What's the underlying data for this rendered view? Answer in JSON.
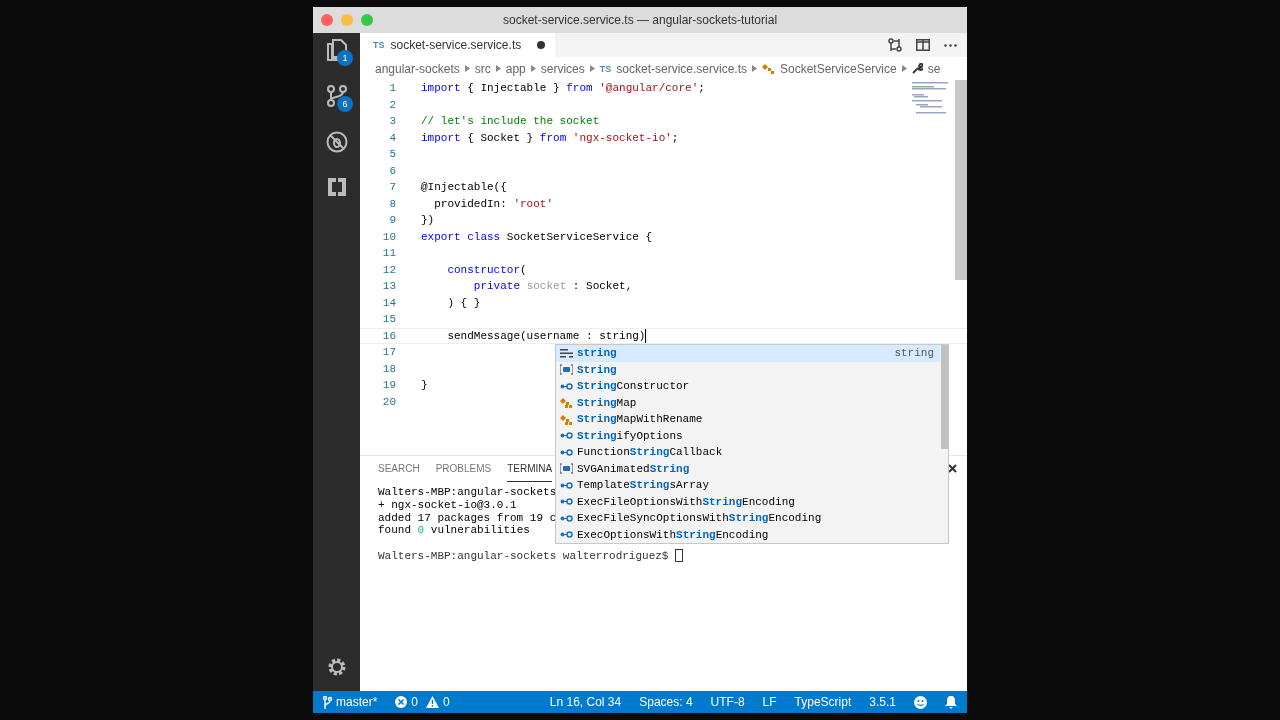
{
  "window": {
    "title": "socket-service.service.ts — angular-sockets-tutorial"
  },
  "activity_bar": {
    "items": [
      {
        "kind": "files",
        "badge": "1"
      },
      {
        "kind": "source-control",
        "badge": "6"
      },
      {
        "kind": "debug"
      },
      {
        "kind": "extensions"
      }
    ]
  },
  "tab": {
    "icon_text": "TS",
    "label": "socket-service.service.ts",
    "dirty": true
  },
  "breadcrumbs": [
    {
      "kind": "folder",
      "label": "angular-sockets"
    },
    {
      "kind": "folder",
      "label": "src"
    },
    {
      "kind": "folder",
      "label": "app"
    },
    {
      "kind": "folder",
      "label": "services"
    },
    {
      "kind": "file",
      "icon_text": "TS",
      "label": "socket-service.service.ts"
    },
    {
      "kind": "class",
      "label": "SocketServiceService"
    },
    {
      "kind": "property",
      "label": "se"
    }
  ],
  "code_lines": [
    {
      "number": "1",
      "current": false,
      "tokens": [
        {
          "text": "import",
          "kind": "kw"
        },
        {
          "text": " { Injectable } ",
          "kind": "plain"
        },
        {
          "text": "from",
          "kind": "kw"
        },
        {
          "text": " '@angular/core'",
          "kind": "str"
        },
        {
          "text": ";",
          "kind": "plain"
        }
      ]
    },
    {
      "number": "2",
      "current": false
    },
    {
      "number": "3",
      "current": false,
      "tokens": [
        {
          "text": "// let's include the socket",
          "kind": "com"
        }
      ]
    },
    {
      "number": "4",
      "current": false,
      "tokens": [
        {
          "text": "import",
          "kind": "kw"
        },
        {
          "text": " { Socket } ",
          "kind": "plain"
        },
        {
          "text": "from",
          "kind": "kw"
        },
        {
          "text": " 'ngx-socket-io'",
          "kind": "str"
        },
        {
          "text": ";",
          "kind": "plain"
        }
      ]
    },
    {
      "number": "5",
      "current": false
    },
    {
      "number": "6",
      "current": false
    },
    {
      "number": "7",
      "current": false,
      "tokens": [
        {
          "text": "@Injectable({",
          "kind": "plain"
        }
      ]
    },
    {
      "number": "8",
      "current": false,
      "tokens": [
        {
          "text": "  providedIn: ",
          "kind": "plain"
        },
        {
          "text": "'root'",
          "kind": "str"
        }
      ]
    },
    {
      "number": "9",
      "current": false,
      "tokens": [
        {
          "text": "})",
          "kind": "plain"
        }
      ]
    },
    {
      "number": "10",
      "current": false,
      "tokens": [
        {
          "text": "export class",
          "kind": "kw"
        },
        {
          "text": " SocketServiceService {",
          "kind": "plain"
        }
      ]
    },
    {
      "number": "11",
      "current": false
    },
    {
      "number": "12",
      "current": false,
      "tokens": [
        {
          "text": "    constructor",
          "kind": "kw"
        },
        {
          "text": "(",
          "kind": "plain"
        }
      ]
    },
    {
      "number": "13",
      "current": false,
      "tokens": [
        {
          "text": "        private",
          "kind": "kw"
        },
        {
          "text": " socket",
          "kind": "dim"
        },
        {
          "text": " : Socket,",
          "kind": "plain"
        }
      ]
    },
    {
      "number": "14",
      "current": false,
      "tokens": [
        {
          "text": "    ) { }",
          "kind": "plain"
        }
      ]
    },
    {
      "number": "15",
      "current": false
    },
    {
      "number": "16",
      "current": true,
      "tokens": [
        {
          "text": "    sendMessage(username : string)",
          "kind": "plain"
        }
      ]
    },
    {
      "number": "17",
      "current": false
    },
    {
      "number": "18",
      "current": false
    },
    {
      "number": "19",
      "current": false,
      "tokens": [
        {
          "text": "}",
          "kind": "plain"
        }
      ]
    },
    {
      "number": "20",
      "current": false
    }
  ],
  "suggestions": [
    {
      "kind": "keyword",
      "selected": true,
      "parts": [
        {
          "text": "string",
          "match": true
        }
      ],
      "detail": "string"
    },
    {
      "kind": "variable",
      "selected": false,
      "parts": [
        {
          "text": "String",
          "match": true
        }
      ]
    },
    {
      "kind": "interface",
      "selected": false,
      "parts": [
        {
          "text": "String",
          "match": true
        },
        {
          "text": "Constructor",
          "match": false
        }
      ]
    },
    {
      "kind": "type-alias",
      "selected": false,
      "parts": [
        {
          "text": "String",
          "match": true
        },
        {
          "text": "Map",
          "match": false
        }
      ]
    },
    {
      "kind": "type-alias",
      "selected": false,
      "parts": [
        {
          "text": "String",
          "match": true
        },
        {
          "text": "MapWithRename",
          "match": false
        }
      ]
    },
    {
      "kind": "interface",
      "selected": false,
      "parts": [
        {
          "text": "String",
          "match": true
        },
        {
          "text": "ifyOptions",
          "match": false
        }
      ]
    },
    {
      "kind": "interface",
      "selected": false,
      "parts": [
        {
          "text": "Function",
          "match": false
        },
        {
          "text": "String",
          "match": true
        },
        {
          "text": "Callback",
          "match": false
        }
      ]
    },
    {
      "kind": "variable",
      "selected": false,
      "parts": [
        {
          "text": "SVGAnimated",
          "match": false
        },
        {
          "text": "String",
          "match": true
        }
      ]
    },
    {
      "kind": "interface",
      "selected": false,
      "parts": [
        {
          "text": "Template",
          "match": false
        },
        {
          "text": "String",
          "match": true
        },
        {
          "text": "sArray",
          "match": false
        }
      ]
    },
    {
      "kind": "interface",
      "selected": false,
      "parts": [
        {
          "text": "ExecFileOptionsWith",
          "match": false
        },
        {
          "text": "String",
          "match": true
        },
        {
          "text": "Encoding",
          "match": false
        }
      ]
    },
    {
      "kind": "interface",
      "selected": false,
      "parts": [
        {
          "text": "ExecFileSyncOptionsWith",
          "match": false
        },
        {
          "text": "String",
          "match": true
        },
        {
          "text": "Encoding",
          "match": false
        }
      ]
    },
    {
      "kind": "interface",
      "selected": false,
      "parts": [
        {
          "text": "ExecOptionsWith",
          "match": false
        },
        {
          "text": "String",
          "match": true
        },
        {
          "text": "Encoding",
          "match": false
        }
      ]
    }
  ],
  "panel": {
    "tabs": [
      {
        "label": "SEARCH",
        "selected": false
      },
      {
        "label": "PROBLEMS",
        "selected": false
      },
      {
        "label": "TERMINA",
        "selected": true
      }
    ],
    "terminal_lines": [
      {
        "segments": [
          {
            "text": "Walters-MBP:angular-sockets",
            "kind": "plain"
          }
        ]
      },
      {
        "segments": [
          {
            "text": "+ ngx-socket-io@3.0.1",
            "kind": "plain"
          }
        ]
      },
      {
        "segments": [
          {
            "text": "added 17 packages from 19 c",
            "kind": "plain"
          }
        ]
      },
      {
        "segments": [
          {
            "text": "found ",
            "kind": "plain"
          },
          {
            "text": "0",
            "kind": "ok"
          },
          {
            "text": " vulnerabilities",
            "kind": "plain"
          }
        ]
      }
    ],
    "prompt": "Walters-MBP:angular-sockets walterrodriguez$ ",
    "terminal_cursor": true
  },
  "status_bar": {
    "branch": "master*",
    "errors": "0",
    "warnings": "0",
    "items": [
      "Ln 16, Col 34",
      "Spaces: 4",
      "UTF-8",
      "LF",
      "TypeScript",
      "3.5.1"
    ]
  }
}
